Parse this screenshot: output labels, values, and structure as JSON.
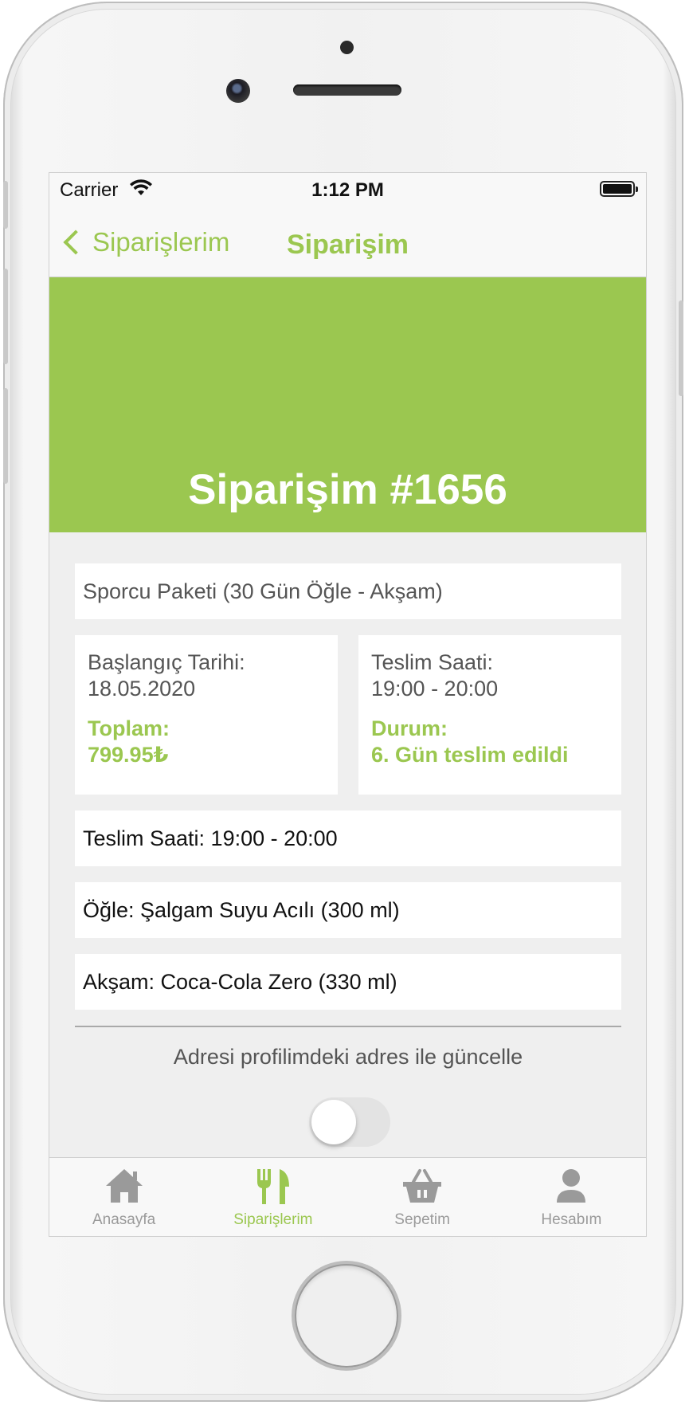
{
  "status_bar": {
    "carrier": "Carrier",
    "time": "1:12 PM"
  },
  "nav": {
    "back_label": "Siparişlerim",
    "title": "Siparişim"
  },
  "hero": {
    "title": "Siparişim #1656"
  },
  "order": {
    "package": "Sporcu Paketi (30 Gün Öğle - Akşam)",
    "start_label": "Başlangıç Tarihi:",
    "start_date": "18.05.2020",
    "total_label": "Toplam:",
    "total_value": "799.95₺",
    "delivery_label": "Teslim Saati:",
    "delivery_value": "19:00 - 20:00",
    "status_label": "Durum:",
    "status_value": "6. Gün teslim edildi"
  },
  "rows": [
    "Teslim Saati: 19:00 - 20:00",
    "Öğle: Şalgam Suyu Acılı (300 ml)",
    "Akşam: Coca-Cola Zero (330 ml)"
  ],
  "address_toggle": {
    "label": "Adresi profilimdeki adres ile güncelle",
    "on": false
  },
  "tabs": [
    {
      "label": "Anasayfa",
      "icon": "home-icon",
      "active": false
    },
    {
      "label": "Siparişlerim",
      "icon": "fork-knife-icon",
      "active": true
    },
    {
      "label": "Sepetim",
      "icon": "basket-icon",
      "active": false
    },
    {
      "label": "Hesabım",
      "icon": "user-icon",
      "active": false
    }
  ],
  "colors": {
    "accent": "#9bc750",
    "background": "#efefef",
    "inactive_tab": "#9a9a9a"
  }
}
